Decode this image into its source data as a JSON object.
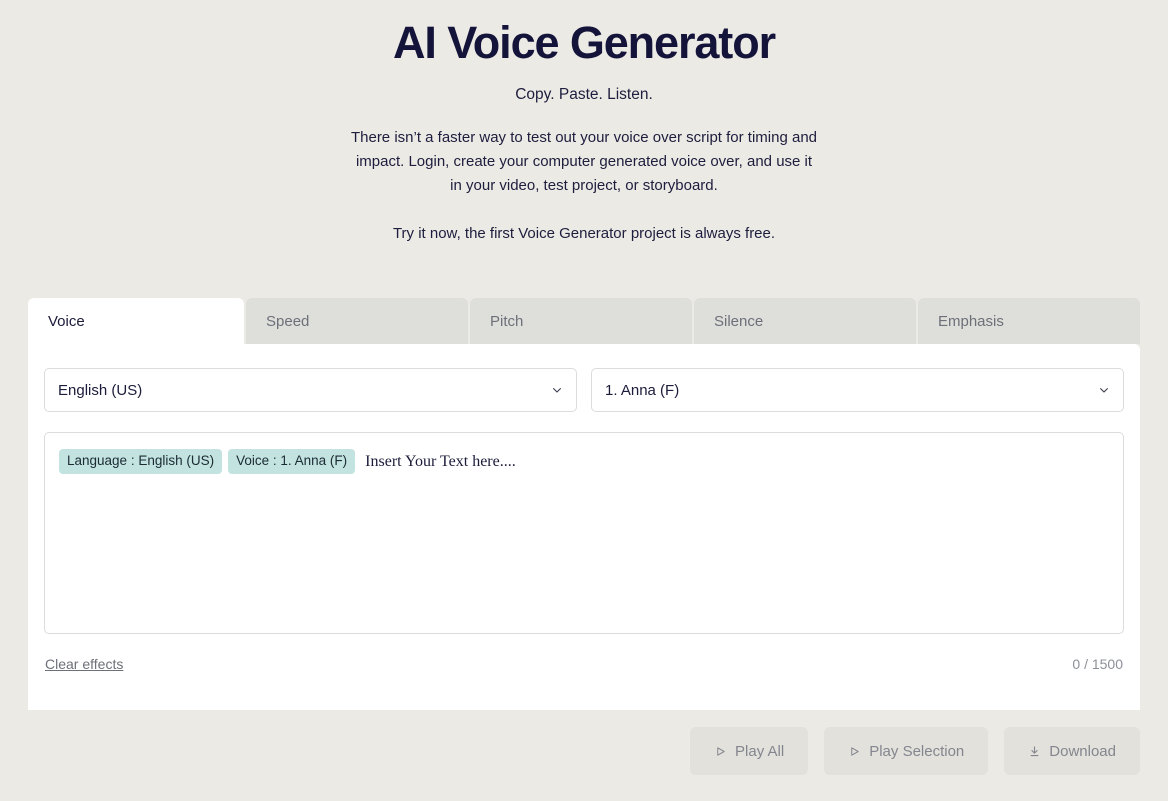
{
  "hero": {
    "title": "AI Voice Generator",
    "tagline": "Copy. Paste. Listen.",
    "paragraph1": "There isn’t a faster way to test out your voice over script for timing and impact. Login, create your computer generated voice over, and use it in your video, test project, or storyboard.",
    "paragraph2": "Try it now, the first Voice Generator project is always free."
  },
  "tabs": [
    {
      "label": "Voice",
      "active": true
    },
    {
      "label": "Speed",
      "active": false
    },
    {
      "label": "Pitch",
      "active": false
    },
    {
      "label": "Silence",
      "active": false
    },
    {
      "label": "Emphasis",
      "active": false
    }
  ],
  "controls": {
    "language_select": {
      "value": "English (US)",
      "icon": "chevron-down-icon"
    },
    "voice_select": {
      "value": "1. Anna (F)",
      "icon": "chevron-down-icon"
    }
  },
  "editor": {
    "chips": [
      {
        "label": "Language : English (US)"
      },
      {
        "label": "Voice : 1. Anna (F)"
      }
    ],
    "placeholder": "Insert Your Text here...."
  },
  "footer": {
    "clear_label": "Clear effects",
    "counter": "0 / 1500"
  },
  "actions": [
    {
      "label": "Play All",
      "icon": "play-icon",
      "glyph": "▷"
    },
    {
      "label": "Play Selection",
      "icon": "play-icon",
      "glyph": "▷"
    },
    {
      "label": "Download",
      "icon": "download-icon",
      "glyph": "⤓"
    }
  ],
  "colors": {
    "page_background": "#eceae5",
    "card_background": "#ffffff",
    "tab_inactive": "#dedfda",
    "title": "#141339",
    "chip": "#c3e3e1",
    "button": "#e2e1dc",
    "muted_text": "#6d7079"
  }
}
